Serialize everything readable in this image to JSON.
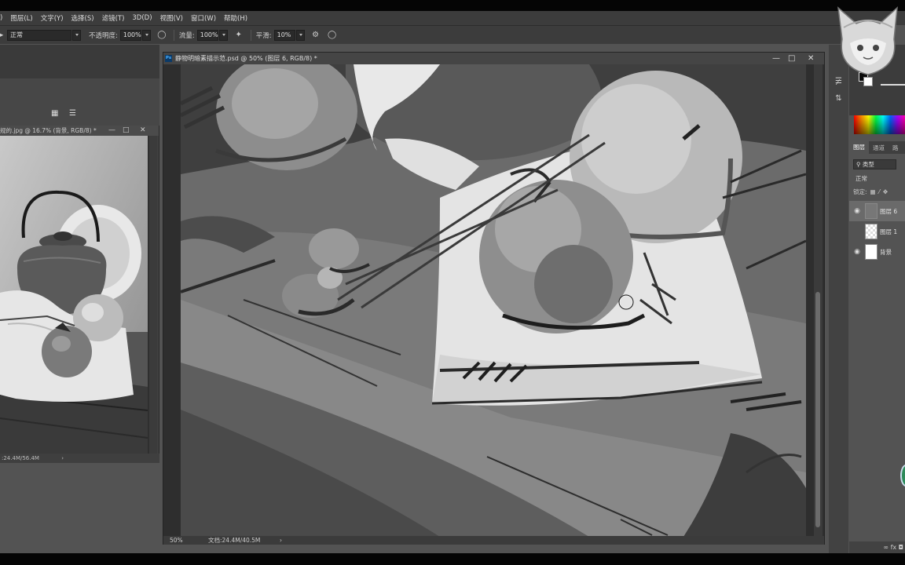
{
  "menu": {
    "items": [
      "图层(L)",
      "文字(Y)",
      "选择(S)",
      "滤镜(T)",
      "3D(D)",
      "视图(V)",
      "窗口(W)",
      "帮助(H)"
    ],
    "partial_first": ")"
  },
  "options": {
    "partial_left": "▸",
    "mode_value": "正常",
    "opacity_label": "不透明度:",
    "opacity_value": "100%",
    "flow_label": "流量:",
    "flow_value": "100%",
    "smoothing_label": "平滑:",
    "smoothing_value": "10%"
  },
  "ref_window": {
    "title": "规的.jpg @ 16.7% (背景, RGB/8) *",
    "status": ":24.4M/56.4M"
  },
  "main_window": {
    "badge": "Ps",
    "title": "静物明暗素描示范.psd @ 50% (图层 6, RGB/8) *",
    "zoom": "50%",
    "doc_info": "文档:24.4M/40.5M"
  },
  "layers_panel": {
    "tabs": [
      "图层",
      "通道",
      "路"
    ],
    "filter_label": "类型",
    "blend_mode": "正常",
    "lock_label": "锁定:",
    "layers": [
      {
        "name": "图层 6",
        "visible": true,
        "selected": true
      },
      {
        "name": "图层 1",
        "visible": false,
        "selected": false
      },
      {
        "name": "背景",
        "visible": true,
        "selected": false
      }
    ],
    "bottom_icons": "∞  fx  ◘"
  },
  "colors": {
    "app_bg": "#535353",
    "chrome": "#3c3c3c",
    "ps_blue": "#4bb0ff"
  }
}
